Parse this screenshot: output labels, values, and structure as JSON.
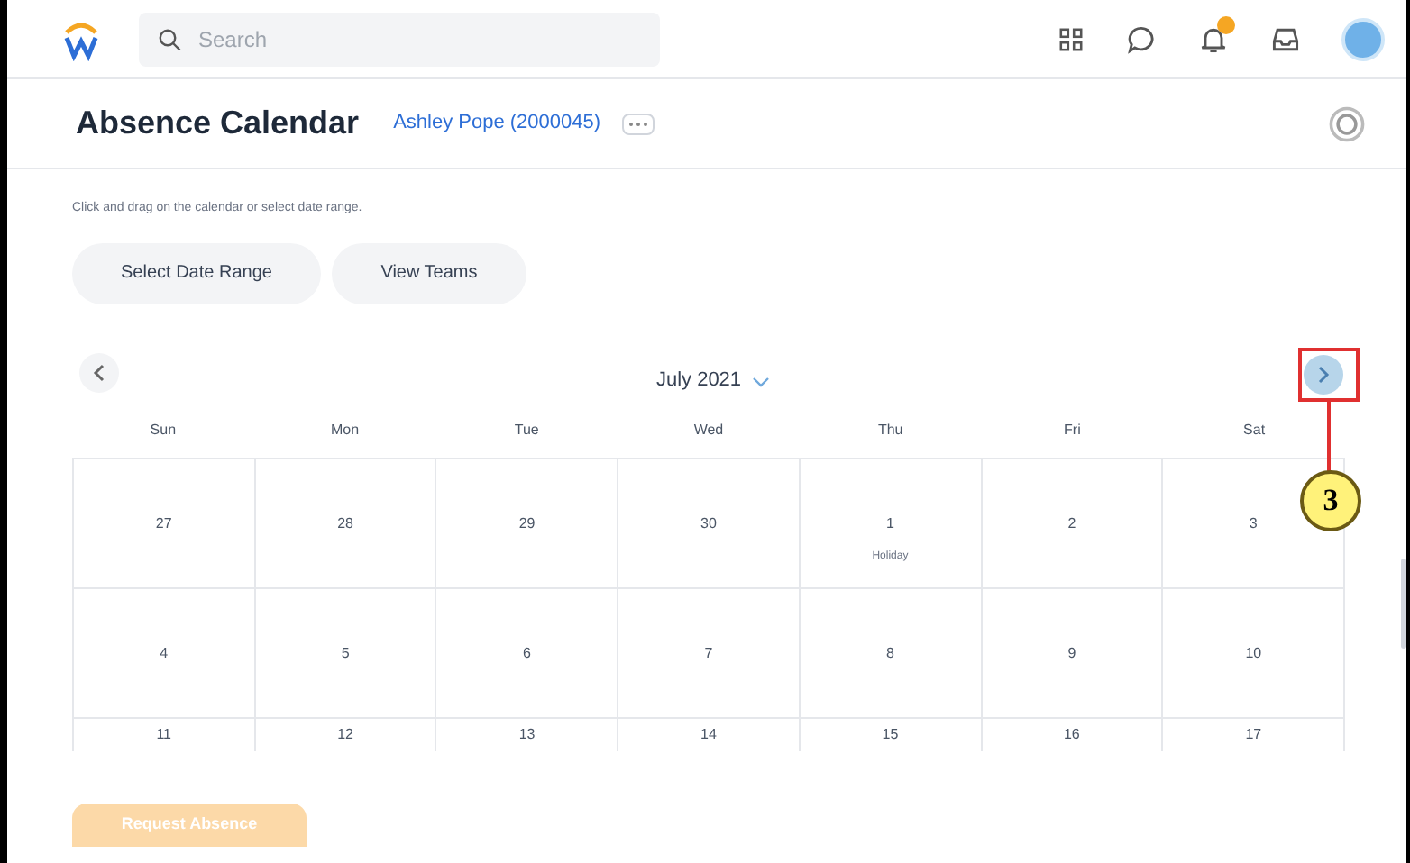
{
  "top_bar": {
    "search": {
      "placeholder": "Search"
    },
    "notification_badge": true
  },
  "header": {
    "title": "Absence Calendar",
    "worker_link": "Ashley Pope (2000045)"
  },
  "instructions": "Click and drag on the calendar or select date range.",
  "buttons": [
    "Select Date Range",
    "View Teams"
  ],
  "calendar": {
    "month": "July 2021",
    "weekdays": [
      "Sun",
      "Mon",
      "Tue",
      "Wed",
      "Thu",
      "Fri",
      "Sat"
    ],
    "weeks": [
      [
        {
          "day": "27"
        },
        {
          "day": "28"
        },
        {
          "day": "29"
        },
        {
          "day": "30"
        },
        {
          "day": "1",
          "note": "Holiday"
        },
        {
          "day": "2"
        },
        {
          "day": "3"
        }
      ],
      [
        {
          "day": "4"
        },
        {
          "day": "5"
        },
        {
          "day": "6"
        },
        {
          "day": "7"
        },
        {
          "day": "8"
        },
        {
          "day": "9"
        },
        {
          "day": "10"
        }
      ],
      [
        {
          "day": "11"
        },
        {
          "day": "12"
        },
        {
          "day": "13"
        },
        {
          "day": "14"
        },
        {
          "day": "15"
        },
        {
          "day": "16"
        },
        {
          "day": "17"
        }
      ]
    ]
  },
  "callout": {
    "number": "3"
  },
  "primary_button": "Request Absence"
}
